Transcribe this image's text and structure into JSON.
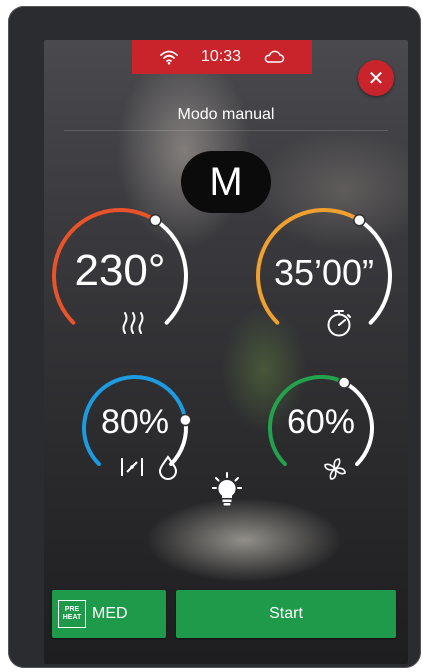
{
  "status_bar": {
    "time": "10:33"
  },
  "header": {
    "mode_title": "Modo manual",
    "mode_badge": "M"
  },
  "dials": {
    "temperature": {
      "value": "230°",
      "level": 0.62,
      "color": "#e8532a"
    },
    "time": {
      "value": "35’00”",
      "level": 0.62,
      "color": "#f0a030"
    },
    "humidity": {
      "value": "80%",
      "level": 0.8,
      "color": "#1d9be0"
    },
    "fan": {
      "value": "60%",
      "level": 0.6,
      "color": "#23a24d"
    }
  },
  "footer": {
    "preheat_badge_top": "PRE",
    "preheat_badge_bottom": "HEAT",
    "preheat_label": "MED",
    "start_label": "Start"
  },
  "icons": [
    "wifi-icon",
    "cloud-icon",
    "close-icon",
    "heat-waves-icon",
    "stopwatch-icon",
    "vent-valve-icon",
    "droplet-icon",
    "fan-icon",
    "light-bulb-icon"
  ],
  "colors": {
    "brand_red": "#c9232b",
    "action_green": "#1e9a4a"
  }
}
